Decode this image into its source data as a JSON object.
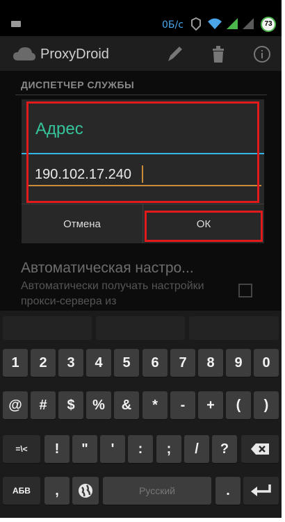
{
  "status_bar": {
    "speed": "0Б/с",
    "battery": "73"
  },
  "app": {
    "title": "ProxyDroid"
  },
  "section": {
    "header": "ДИСПЕТЧЕР СЛУЖБЫ"
  },
  "dialog": {
    "title": "Адрес",
    "address_value": "190.102.17.240",
    "cancel_label": "Отмена",
    "ok_label": "ОК"
  },
  "background_item": {
    "title": "Автоматическая настро...",
    "description": "Автоматически получать настройки прокси-сервера из"
  },
  "keyboard": {
    "row1": [
      "1",
      "2",
      "3",
      "4",
      "5",
      "6",
      "7",
      "8",
      "9",
      "0"
    ],
    "row2": [
      "@",
      "#",
      "$",
      "%",
      "&",
      "*",
      "-",
      "+",
      "(",
      ")"
    ],
    "row3": [
      "=\\<",
      "!",
      "\"",
      "'",
      ":",
      ";",
      "/",
      "?"
    ],
    "row4": {
      "abc": "АБВ",
      "comma": ",",
      "space": "Русский",
      "period": "."
    }
  },
  "colors": {
    "accent": "#33b5e5",
    "title_green": "#36c49b",
    "annotation_red": "#e11b1b",
    "input_underline": "#c98b3a"
  },
  "icons": [
    "menu-icon",
    "mobile-data-icon",
    "wifi-icon",
    "signal-icon",
    "battery-icon",
    "cloud-icon",
    "pencil-icon",
    "trash-icon",
    "info-icon",
    "globe-icon",
    "backspace-icon",
    "enter-icon"
  ]
}
